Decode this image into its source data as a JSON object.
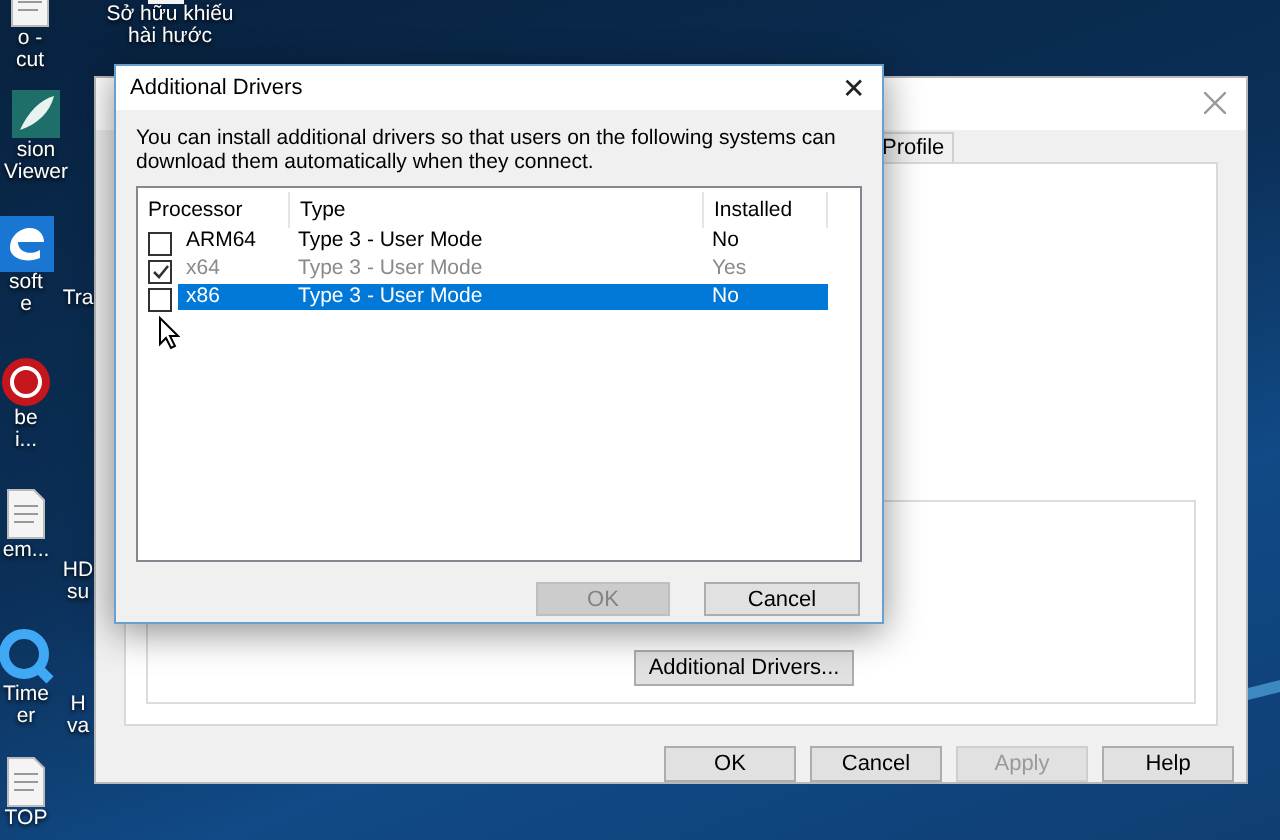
{
  "desktop_icons": [
    {
      "lines": [
        "o -",
        "cut"
      ]
    },
    {
      "lines": [
        "sion",
        "Viewer"
      ]
    },
    {
      "lines": [
        "soft",
        "e"
      ]
    },
    {
      "lines": [
        "be",
        "i..."
      ]
    },
    {
      "lines": [
        "em..."
      ]
    },
    {
      "lines": [
        "Time",
        "er"
      ]
    },
    {
      "lines": [
        "TOP"
      ]
    },
    {
      "lines": [
        "Sở hữu khiếu",
        "hài hước"
      ]
    },
    {
      "lines": [
        "Tra"
      ]
    },
    {
      "lines": [
        "HD",
        "su"
      ]
    },
    {
      "lines": [
        "H",
        "va"
      ]
    }
  ],
  "back_window": {
    "tabs": [
      {
        "label": "Profile",
        "selected": false
      }
    ],
    "additional_drivers_button": "Additional Drivers...",
    "buttons": [
      {
        "label": "OK",
        "disabled": false
      },
      {
        "label": "Cancel",
        "disabled": false
      },
      {
        "label": "Apply",
        "disabled": true
      },
      {
        "label": "Help",
        "disabled": false
      }
    ]
  },
  "dialog": {
    "title": "Additional Drivers",
    "close": "✕",
    "description": "You can install additional drivers so that users on the following systems can download them automatically when they connect.",
    "columns": [
      "Processor",
      "Type",
      "Installed"
    ],
    "rows": [
      {
        "processor": "ARM64",
        "type": "Type 3 - User Mode",
        "installed": "No",
        "checked": false,
        "disabled": false,
        "selected": false
      },
      {
        "processor": "x64",
        "type": "Type 3 - User Mode",
        "installed": "Yes",
        "checked": true,
        "disabled": true,
        "selected": false
      },
      {
        "processor": "x86",
        "type": "Type 3 - User Mode",
        "installed": "No",
        "checked": false,
        "disabled": false,
        "selected": true
      }
    ],
    "buttons": [
      {
        "label": "OK",
        "disabled": true
      },
      {
        "label": "Cancel",
        "disabled": false
      }
    ]
  }
}
